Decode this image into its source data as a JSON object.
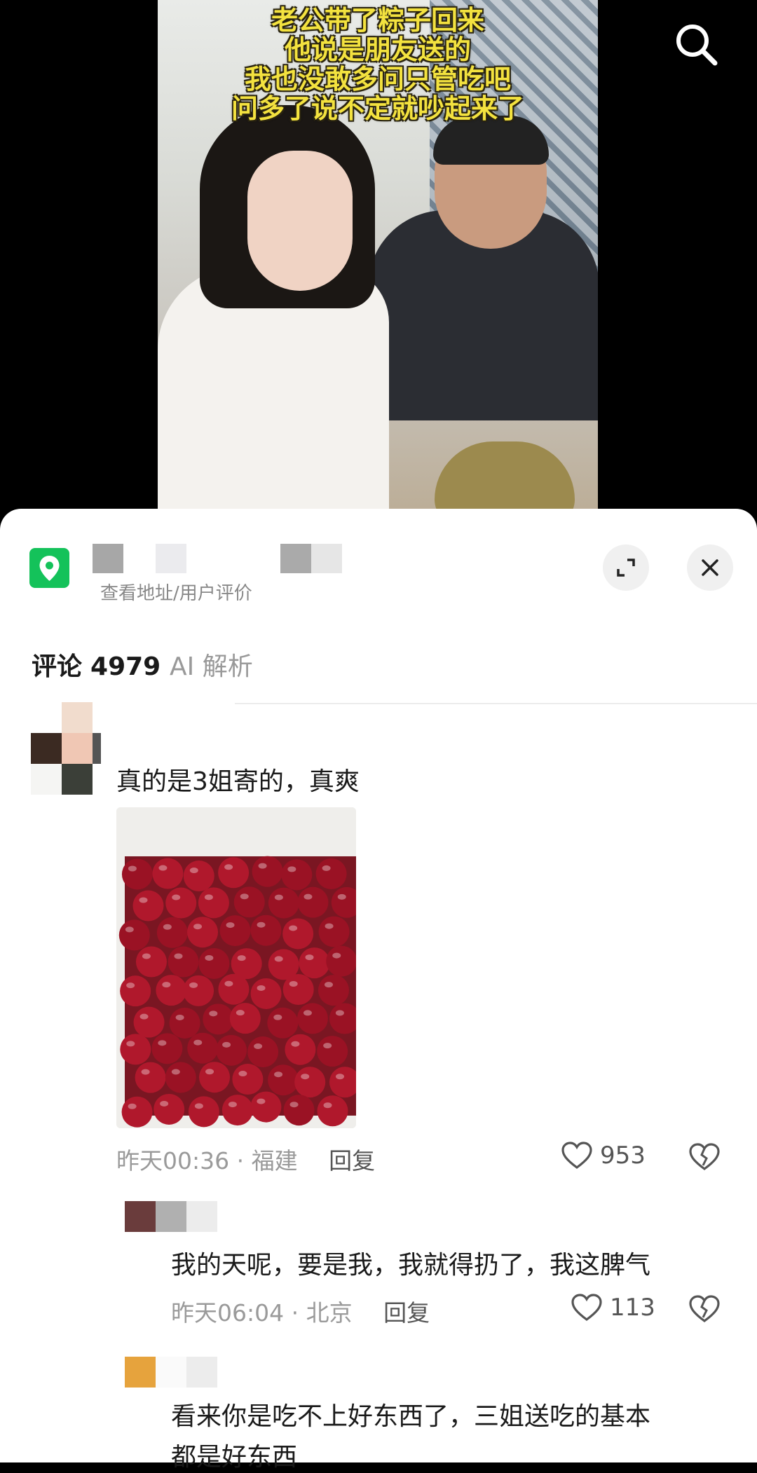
{
  "video": {
    "caption_lines": [
      "老公带了粽子回来",
      "他说是朋友送的",
      "我也没敢多问只管吃吧",
      "问多了说不定就吵起来了"
    ]
  },
  "location": {
    "subtitle": "查看地址/用户评价"
  },
  "tabs": {
    "comments_label": "评论",
    "comments_count": "4979",
    "ai_label": "AI 解析"
  },
  "comments": [
    {
      "text": "真的是3姐寄的，真爽",
      "time": "昨天00:36",
      "region": "福建",
      "reply_label": "回复",
      "likes": "953",
      "has_image": true
    }
  ],
  "replies": [
    {
      "text": "我的天呢，要是我，我就得扔了，我这脾气",
      "time": "昨天06:04",
      "region": "北京",
      "reply_label": "回复",
      "likes": "113"
    },
    {
      "text_line1": "看来你是吃不上好东西了，三姐送吃的基本",
      "text_line2": "都是好东西"
    }
  ],
  "icons": {
    "search": "search-icon",
    "location": "map-pin-icon",
    "expand": "expand-icon",
    "close": "close-icon",
    "like": "heart-icon",
    "dislike": "broken-heart-icon"
  },
  "colors": {
    "caption": "#f3e23f",
    "location_badge": "#14c25a"
  }
}
